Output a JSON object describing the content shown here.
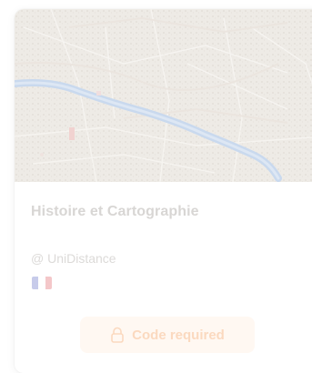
{
  "card": {
    "title": "Histoire et Cartographie",
    "organization": "@ UniDistance",
    "language_flag_icon": "france-flag-icon",
    "code_button": {
      "label": "Code required",
      "icon": "lock-icon"
    }
  },
  "colors": {
    "title": "#d8d6d4",
    "organization": "#dcdad8",
    "button_bg": "#fff8f2",
    "button_text": "#fbd9bf",
    "river": "#c9d9ee"
  }
}
